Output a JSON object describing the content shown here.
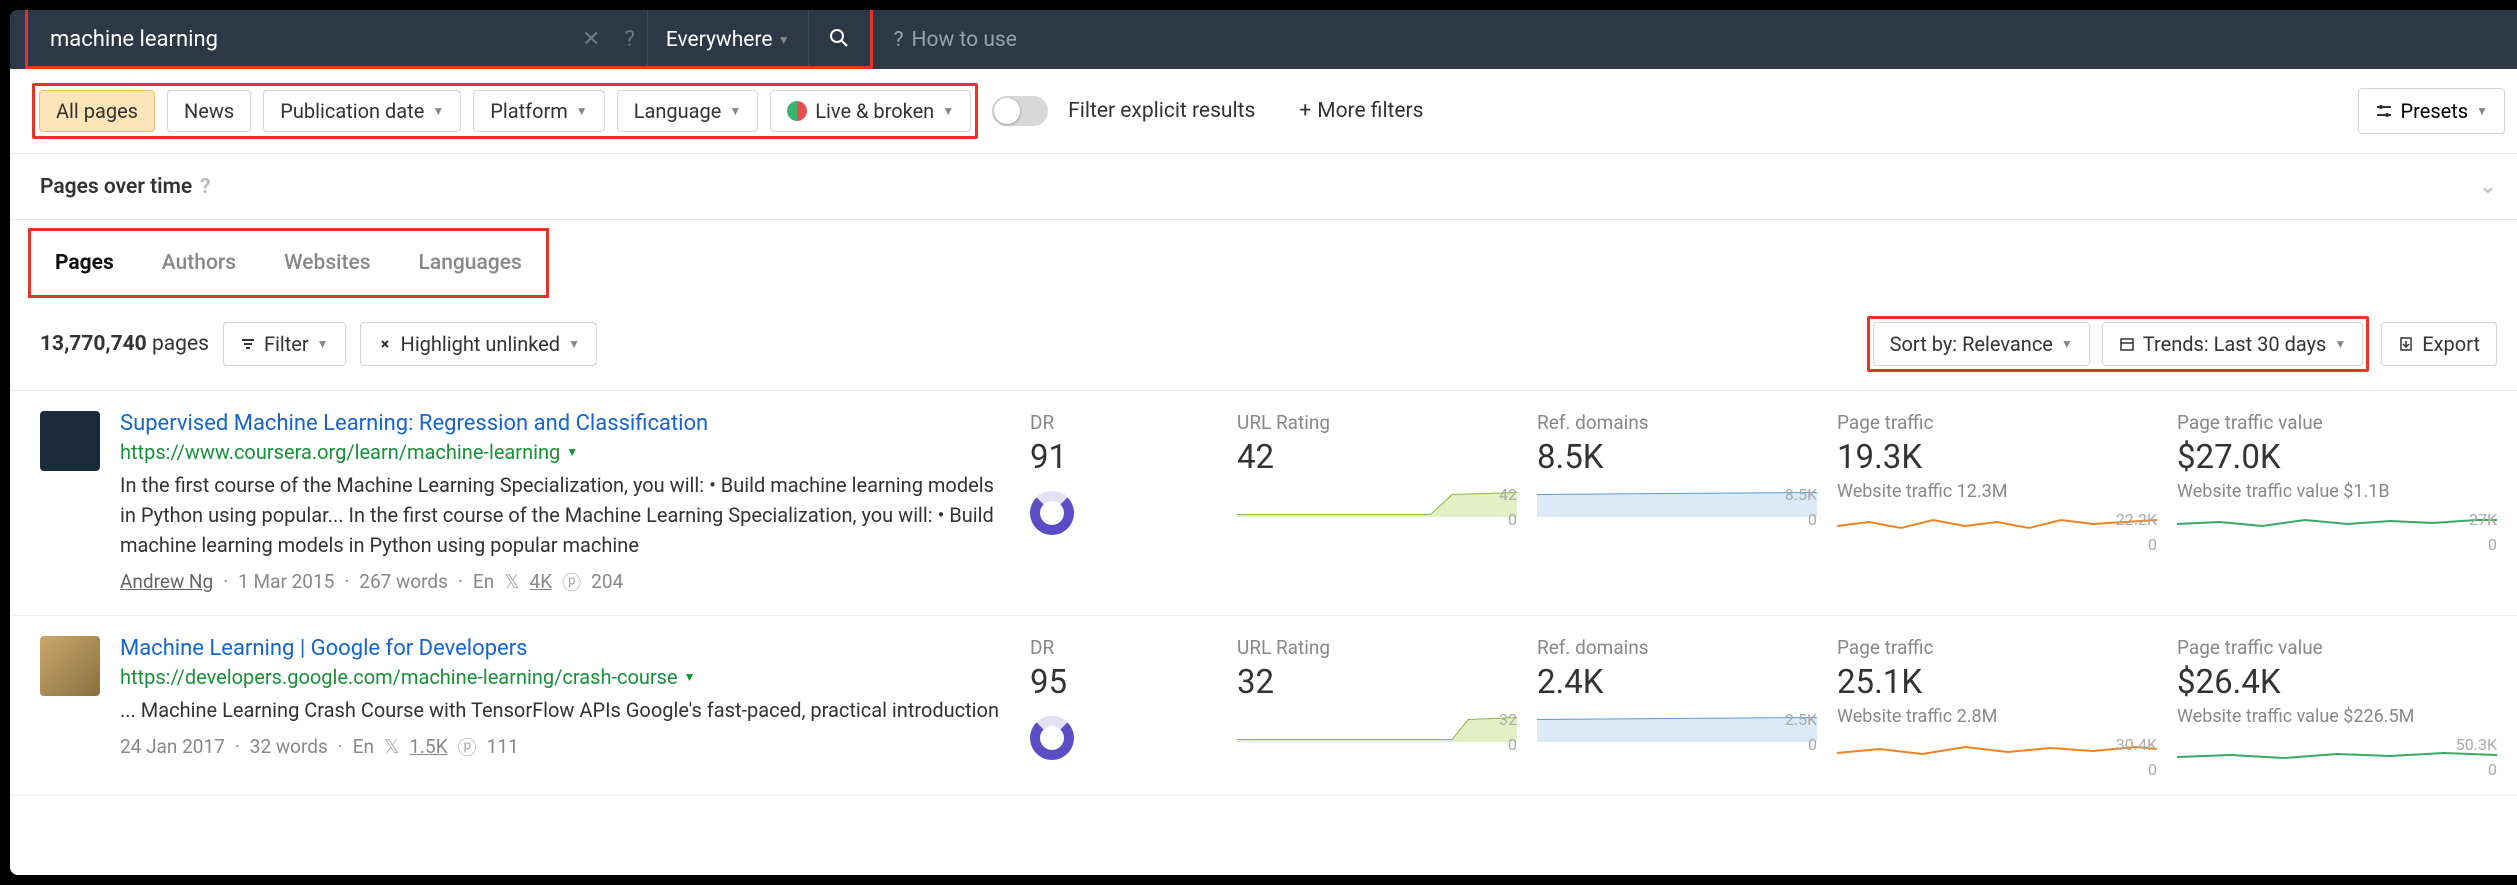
{
  "search": {
    "query": "machine learning",
    "scope": "Everywhere",
    "how_to_use": "How to use"
  },
  "filters": {
    "all_pages": "All pages",
    "news": "News",
    "pub_date": "Publication date",
    "platform": "Platform",
    "language": "Language",
    "live_broken": "Live & broken",
    "explicit": "Filter explicit results",
    "more": "More filters",
    "presets": "Presets"
  },
  "pot": {
    "title": "Pages over time"
  },
  "tabs": {
    "pages": "Pages",
    "authors": "Authors",
    "websites": "Websites",
    "languages": "Languages"
  },
  "controls": {
    "count": "13,770,740",
    "count_label": "pages",
    "filter": "Filter",
    "highlight": "Highlight unlinked",
    "sort": "Sort by: Relevance",
    "trends": "Trends: Last 30 days",
    "export": "Export"
  },
  "cols": {
    "dr": "DR",
    "url_rating": "URL Rating",
    "ref": "Ref. domains",
    "traffic": "Page traffic",
    "value": "Page traffic value"
  },
  "rows": [
    {
      "title": "Supervised Machine Learning: Regression and Classification",
      "url": "https://www.coursera.org/learn/machine-learning",
      "desc": "In the first course of the Machine Learning Specialization, you will: • Build machine learning models in Python using popular... In the first course of the Machine Learning Specialization, you will: • Build machine learning models in Python using popular machine",
      "author": "Andrew Ng",
      "date": "1 Mar 2015",
      "words": "267 words",
      "lang": "En",
      "tw": "4K",
      "pin": "204",
      "dr": "91",
      "url_rating": "42",
      "ur_max": "42",
      "ur_min": "0",
      "ref": "8.5K",
      "ref_max": "8.5K",
      "ref_min": "0",
      "traffic": "19.3K",
      "traffic_sub": "Website traffic 12.3M",
      "tr_max": "22.2K",
      "tr_min": "0",
      "value": "$27.0K",
      "value_sub": "Website traffic value $1.1B",
      "v_max": "27K",
      "v_min": "0"
    },
    {
      "title": "Machine Learning | Google for Developers",
      "url": "https://developers.google.com/machine-learning/crash-course",
      "desc": "... Machine Learning Crash Course with TensorFlow APIs Google's fast-paced, practical introduction",
      "author": "",
      "date": "24 Jan 2017",
      "words": "32 words",
      "lang": "En",
      "tw": "1.5K",
      "pin": "111",
      "dr": "95",
      "url_rating": "32",
      "ur_max": "32",
      "ur_min": "0",
      "ref": "2.4K",
      "ref_max": "2.5K",
      "ref_min": "0",
      "traffic": "25.1K",
      "traffic_sub": "Website traffic 2.8M",
      "tr_max": "30.4K",
      "tr_min": "0",
      "value": "$26.4K",
      "value_sub": "Website traffic value $226.5M",
      "v_max": "50.3K",
      "v_min": "0"
    }
  ]
}
